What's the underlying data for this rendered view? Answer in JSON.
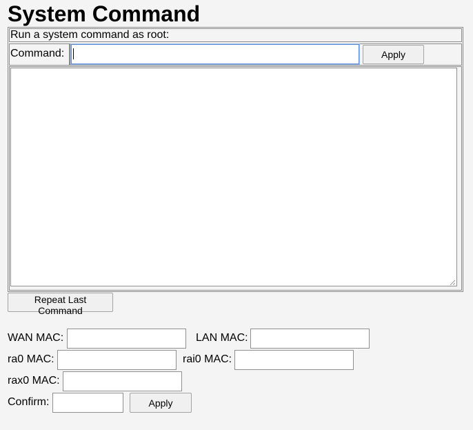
{
  "page": {
    "title": "System Command"
  },
  "command": {
    "header": "Run a system command as root:",
    "label": "Command:",
    "input_value": "",
    "apply_label": "Apply",
    "output_text": "",
    "repeat_label": "Repeat Last Command"
  },
  "mac": {
    "wan_label": "WAN MAC:",
    "lan_label": "LAN MAC:",
    "ra0_label": "ra0 MAC:",
    "rai0_label": "rai0 MAC:",
    "rax0_label": "rax0 MAC:",
    "confirm_label": "Confirm:",
    "wan_value": "",
    "lan_value": "",
    "ra0_value": "",
    "rai0_value": "",
    "rax0_value": "",
    "confirm_value": "",
    "apply_label": "Apply"
  }
}
